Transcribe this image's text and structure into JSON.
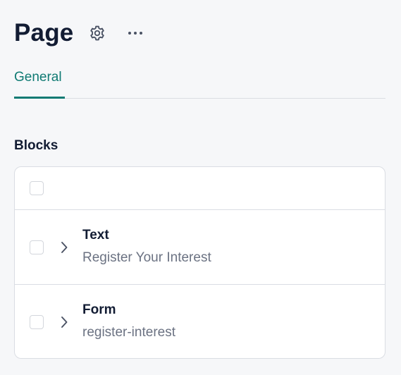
{
  "header": {
    "title": "Page",
    "settings_icon": "gear-icon",
    "more_icon": "more-horizontal-icon"
  },
  "tabs": [
    {
      "label": "General",
      "active": true
    }
  ],
  "blocks": {
    "section_title": "Blocks",
    "rows": [
      {
        "type": "Text",
        "value": "Register Your Interest",
        "icon": "chevron-right-icon"
      },
      {
        "type": "Form",
        "value": "register-interest",
        "icon": "chevron-right-icon"
      }
    ]
  },
  "colors": {
    "accent": "#0f7a73",
    "text_primary": "#121c33",
    "text_secondary": "#6b7282",
    "border": "#dadde3",
    "background": "#f6f7f9"
  }
}
